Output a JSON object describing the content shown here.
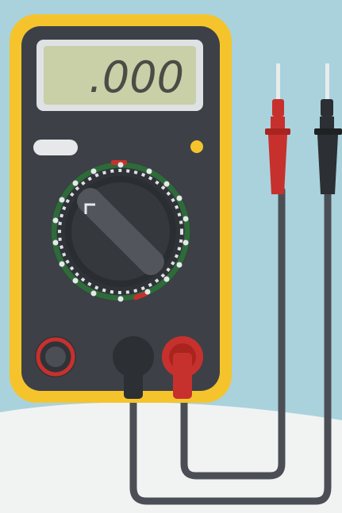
{
  "display": {
    "reading": ".000"
  },
  "colors": {
    "background_sky": "#a9d2dd",
    "background_floor": "#f1f3f3",
    "case_yellow": "#f5c42c",
    "body_dark": "#3d4147",
    "lcd_frame": "#dfe2e4",
    "lcd_screen": "#c9cfa7",
    "lcd_digits": "#4a4d45",
    "dial_ring": "#2e6a3a",
    "probe_red": "#c7312d",
    "probe_black": "#2c2f33",
    "cable_gray": "#4b4f55",
    "indicator_yellow": "#f5c42c"
  },
  "icons": {
    "dial": "rotary-selector-dial",
    "jack_left": "input-jack",
    "jack_black": "com-jack-black-plug",
    "jack_red": "v-ohm-jack-red-plug",
    "probe_red": "red-test-probe",
    "probe_black": "black-test-probe"
  }
}
